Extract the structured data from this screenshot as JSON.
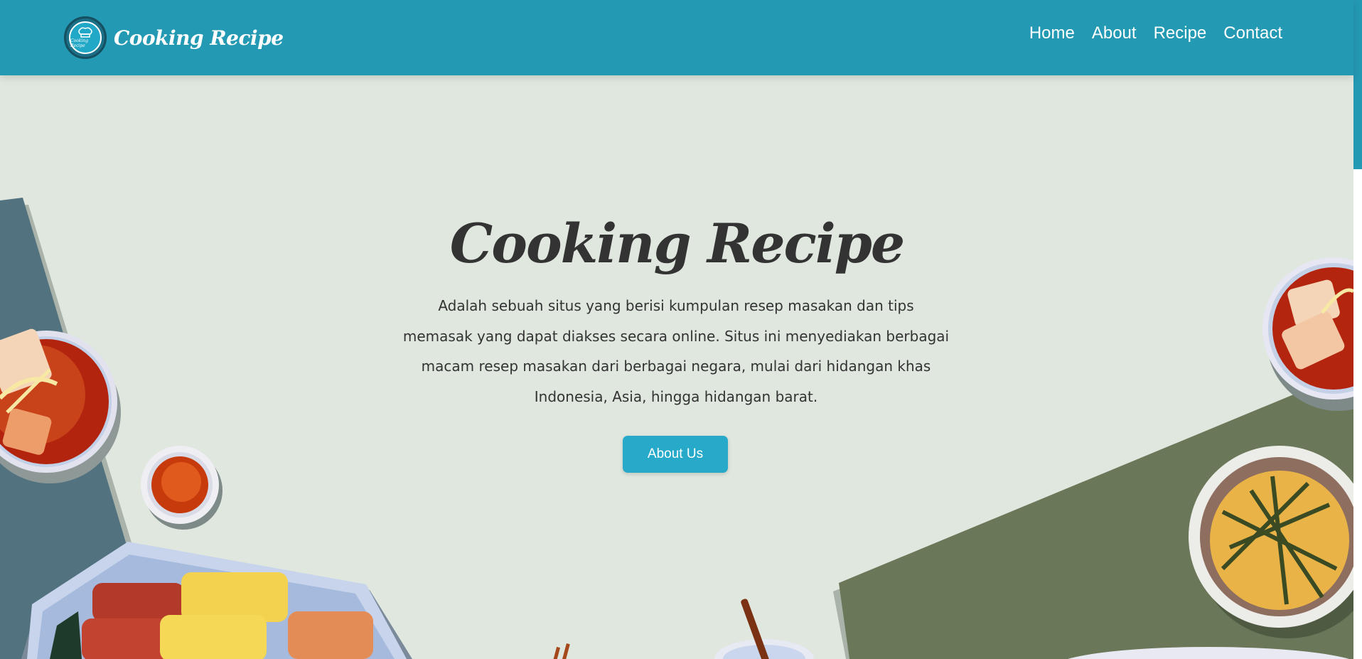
{
  "brand": {
    "logo_text": "Cooking Recipe",
    "title": "Cooking Recipe"
  },
  "nav": {
    "items": [
      "Home",
      "About",
      "Recipe",
      "Contact"
    ]
  },
  "hero": {
    "title": "Cooking Recipe",
    "description": "Adalah sebuah situs yang berisi kumpulan resep masakan dan tips memasak yang dapat diakses secara online. Situs ini menyediakan berbagai macam resep masakan dari berbagai negara, mulai dari hidangan khas Indonesia, Asia, hingga hidangan barat.",
    "button_label": "About Us"
  },
  "colors": {
    "navbar": "#2499b3",
    "background": "#dfe7df",
    "button": "#27a9c9",
    "left_panel": "#52727f",
    "right_panel": "#6a7758"
  },
  "icons": {
    "logo": "chef-hat-icon"
  }
}
